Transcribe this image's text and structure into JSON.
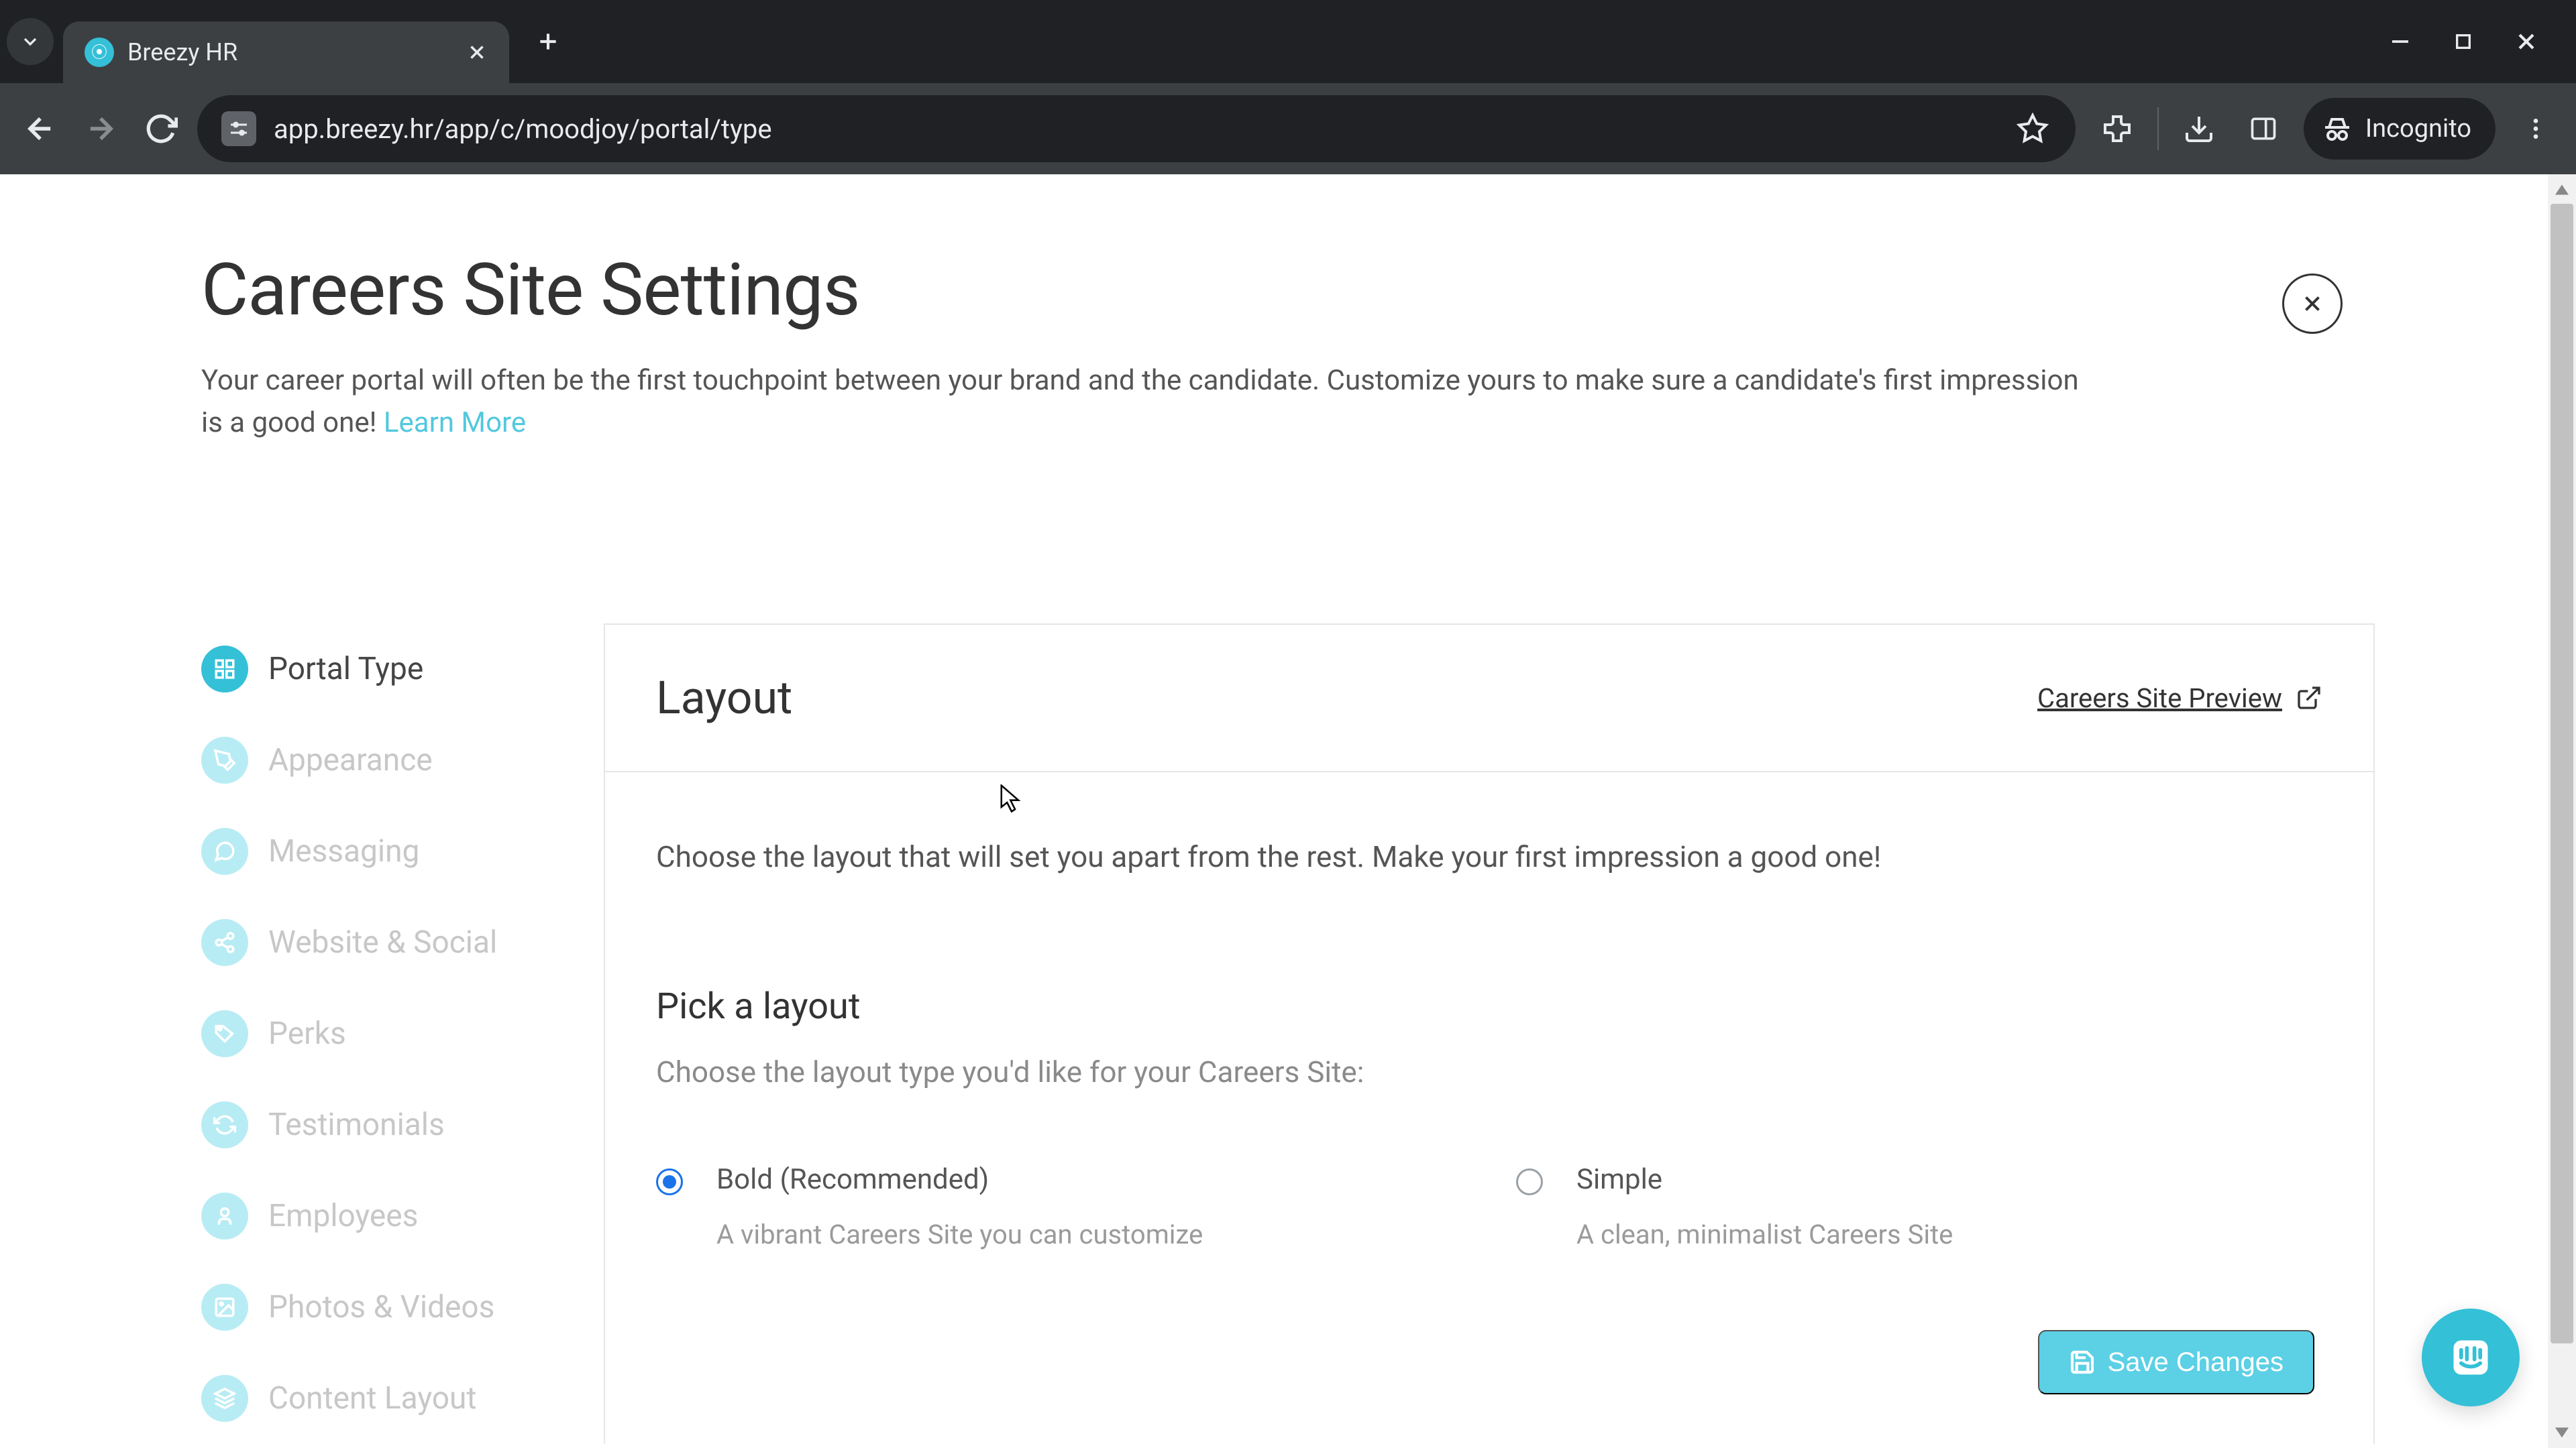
{
  "browser": {
    "tab_title": "Breezy HR",
    "url": "app.breezy.hr/app/c/moodjoy/portal/type",
    "incognito_label": "Incognito"
  },
  "page": {
    "title": "Careers Site Settings",
    "subtitle": "Your career portal will often be the first touchpoint between your brand and the candidate. Customize yours to make sure a candidate's first impression is a good one! ",
    "learn_more": "Learn More"
  },
  "sidebar": {
    "items": [
      {
        "label": "Portal Type",
        "icon": "grid-icon",
        "active": true
      },
      {
        "label": "Appearance",
        "icon": "brush-icon",
        "active": false
      },
      {
        "label": "Messaging",
        "icon": "chat-icon",
        "active": false
      },
      {
        "label": "Website & Social",
        "icon": "share-icon",
        "active": false
      },
      {
        "label": "Perks",
        "icon": "tag-icon",
        "active": false
      },
      {
        "label": "Testimonials",
        "icon": "refresh-icon",
        "active": false
      },
      {
        "label": "Employees",
        "icon": "user-x-icon",
        "active": false
      },
      {
        "label": "Photos & Videos",
        "icon": "image-icon",
        "active": false
      },
      {
        "label": "Content Layout",
        "icon": "layers-icon",
        "active": false
      }
    ]
  },
  "panel": {
    "title": "Layout",
    "preview_link": "Careers Site Preview",
    "lead": "Choose the layout that will set you apart from the rest. Make your first impression a good one!",
    "pick_header": "Pick a layout",
    "pick_sub": "Choose the layout type you'd like for your Careers Site:",
    "options": [
      {
        "title": "Bold (Recommended)",
        "desc": "A vibrant Careers Site you can customize",
        "selected": true
      },
      {
        "title": "Simple",
        "desc": "A clean, minimalist Careers Site",
        "selected": false
      }
    ]
  },
  "actions": {
    "save_label": "Save Changes"
  }
}
